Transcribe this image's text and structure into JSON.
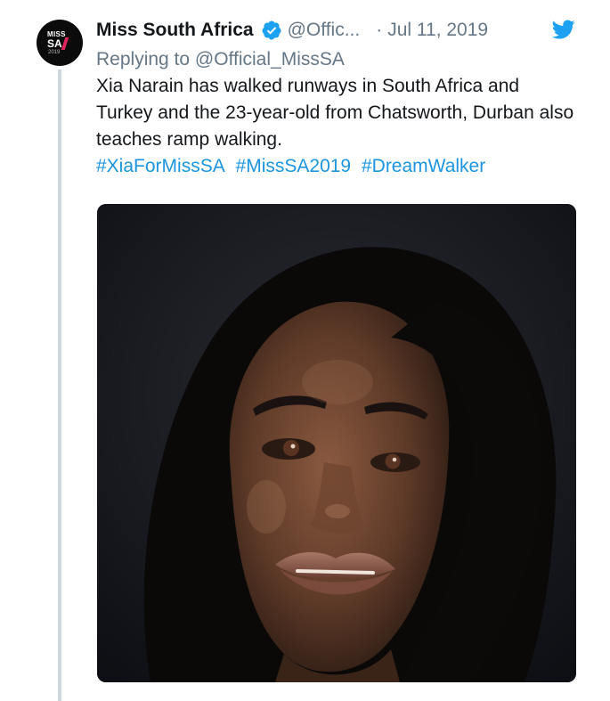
{
  "tweet": {
    "author": {
      "display_name": "Miss South Africa",
      "handle": "@Offic...",
      "verified_icon": "verified-badge-icon",
      "avatar_logo": {
        "miss": "MISS",
        "sa": "SA",
        "year": "2019"
      }
    },
    "separator": "·",
    "date": "Jul 11, 2019",
    "platform_icon": "twitter-bird-icon",
    "replying_prefix": "Replying to",
    "replying_to": "@Official_MissSA",
    "text": "Xia Narain has walked runways in South Africa and Turkey and the 23-year-old from Chatsworth, Durban also teaches ramp walking.",
    "hashtags": [
      "#XiaForMissSA",
      "#MissSA2019",
      "#DreamWalker"
    ],
    "media": {
      "type": "photo",
      "subject": "portrait-photo"
    }
  },
  "colors": {
    "text_primary": "#14171a",
    "text_secondary": "#657786",
    "link": "#1b95e0",
    "verified": "#1da1f2",
    "thread_line": "#ccd6dd"
  }
}
